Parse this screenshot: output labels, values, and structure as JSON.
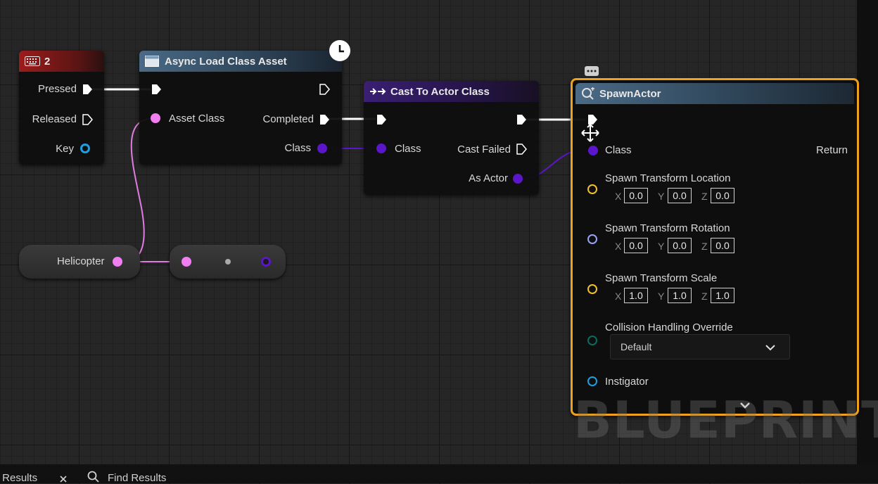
{
  "nodes": {
    "key_event": {
      "title": "2",
      "pins": {
        "pressed": "Pressed",
        "released": "Released",
        "key": "Key"
      }
    },
    "async_load": {
      "title": "Async Load Class Asset",
      "pins": {
        "asset_class": "Asset Class",
        "completed": "Completed",
        "class": "Class"
      }
    },
    "cast": {
      "title": "Cast To Actor Class",
      "pins": {
        "class": "Class",
        "cast_failed": "Cast Failed",
        "as_actor": "As Actor"
      }
    },
    "spawn": {
      "title": "SpawnActor",
      "pins": {
        "class": "Class",
        "return": "Return",
        "location": "Spawn Transform Location",
        "rotation": "Spawn Transform Rotation",
        "scale": "Spawn Transform Scale",
        "collision": "Collision Handling Override",
        "instigator": "Instigator"
      },
      "axes": {
        "x": "X",
        "y": "Y",
        "z": "Z"
      },
      "location": {
        "x": "0.0",
        "y": "0.0",
        "z": "0.0"
      },
      "rotation": {
        "x": "0.0",
        "y": "0.0",
        "z": "0.0"
      },
      "scale": {
        "x": "1.0",
        "y": "1.0",
        "z": "1.0"
      },
      "collision_value": "Default"
    },
    "variable": {
      "label": "Helicopter"
    }
  },
  "watermark": "BLUEPRINT",
  "bottom_tabs": [
    {
      "label": "r Results"
    },
    {
      "label": "Find Results"
    }
  ],
  "colors": {
    "exec": "#ffffff",
    "class_pin": "#5b16c9",
    "soft_class_pin": "#f07ef0",
    "vector_pin": "#f2c12e",
    "rotator_pin": "#9aa3f5",
    "byte_pin": "#0b6b5e",
    "object_pin": "#1e9fe0",
    "selection": "#f0a11c"
  }
}
